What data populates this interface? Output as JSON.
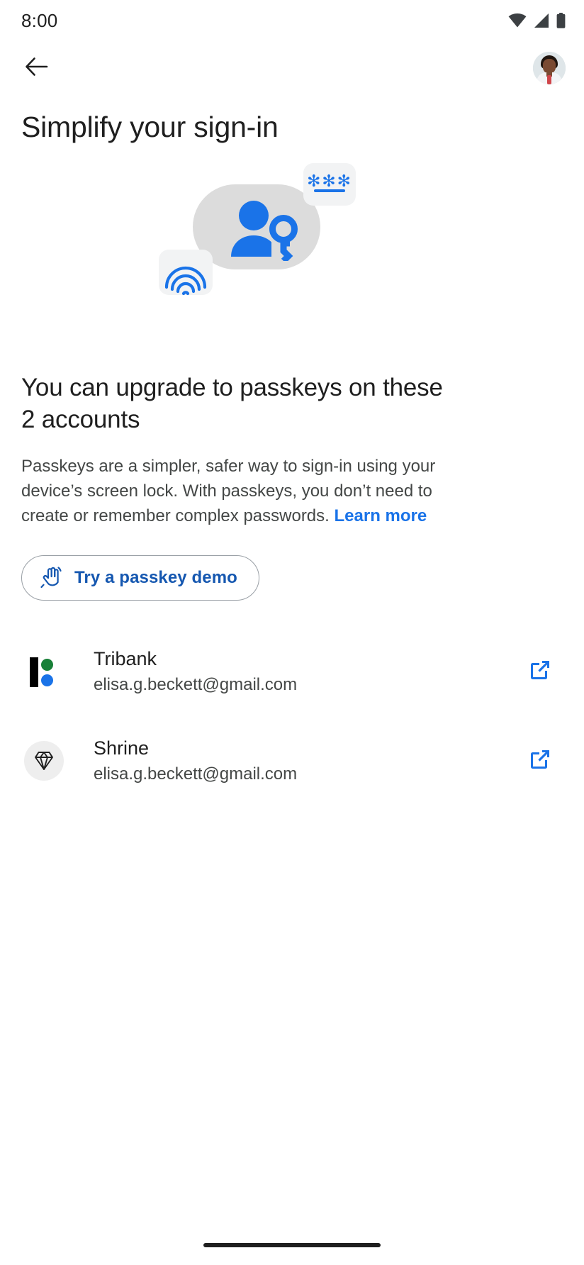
{
  "status_bar": {
    "time": "8:00",
    "icons": [
      "wifi-icon",
      "cellular-signal-icon",
      "battery-icon"
    ]
  },
  "app_bar": {
    "back_icon": "back-arrow-icon",
    "avatar_label": "Account avatar"
  },
  "page_title": "Simplify your sign-in",
  "illustration": {
    "person_key_icon": "person-with-key-icon",
    "password_card": {
      "masked_chars": "✻✻✻",
      "field_underline": true
    },
    "fingerprint_icon": "fingerprint-icon",
    "blob_color": "#dcdcdc",
    "accent_color": "#1a73e8"
  },
  "main": {
    "headline": "You can upgrade to passkeys on these 2 accounts",
    "body_text": "Passkeys are a simpler, safer way to sign-in using your device’s screen lock. With passkeys, you don’t need to create or remember complex passwords. ",
    "learn_more_label": "Learn more",
    "demo_button": {
      "label": "Try a passkey demo",
      "icon": "touch-gesture-icon",
      "text_color": "#1557b0"
    }
  },
  "accounts": [
    {
      "name": "Tribank",
      "email": "elisa.g.beckett@gmail.com",
      "icon": "tribank-logo-icon",
      "action_icon": "open-in-new-icon"
    },
    {
      "name": "Shrine",
      "email": "elisa.g.beckett@gmail.com",
      "icon": "shrine-diamond-icon",
      "action_icon": "open-in-new-icon"
    }
  ],
  "nav_bar": {
    "home_indicator": "home-indicator"
  },
  "colors": {
    "accent_blue": "#1a73e8",
    "link_blue": "#1557b0",
    "text_primary": "#1f1f1f",
    "text_secondary": "#444746",
    "green": "#188038"
  }
}
